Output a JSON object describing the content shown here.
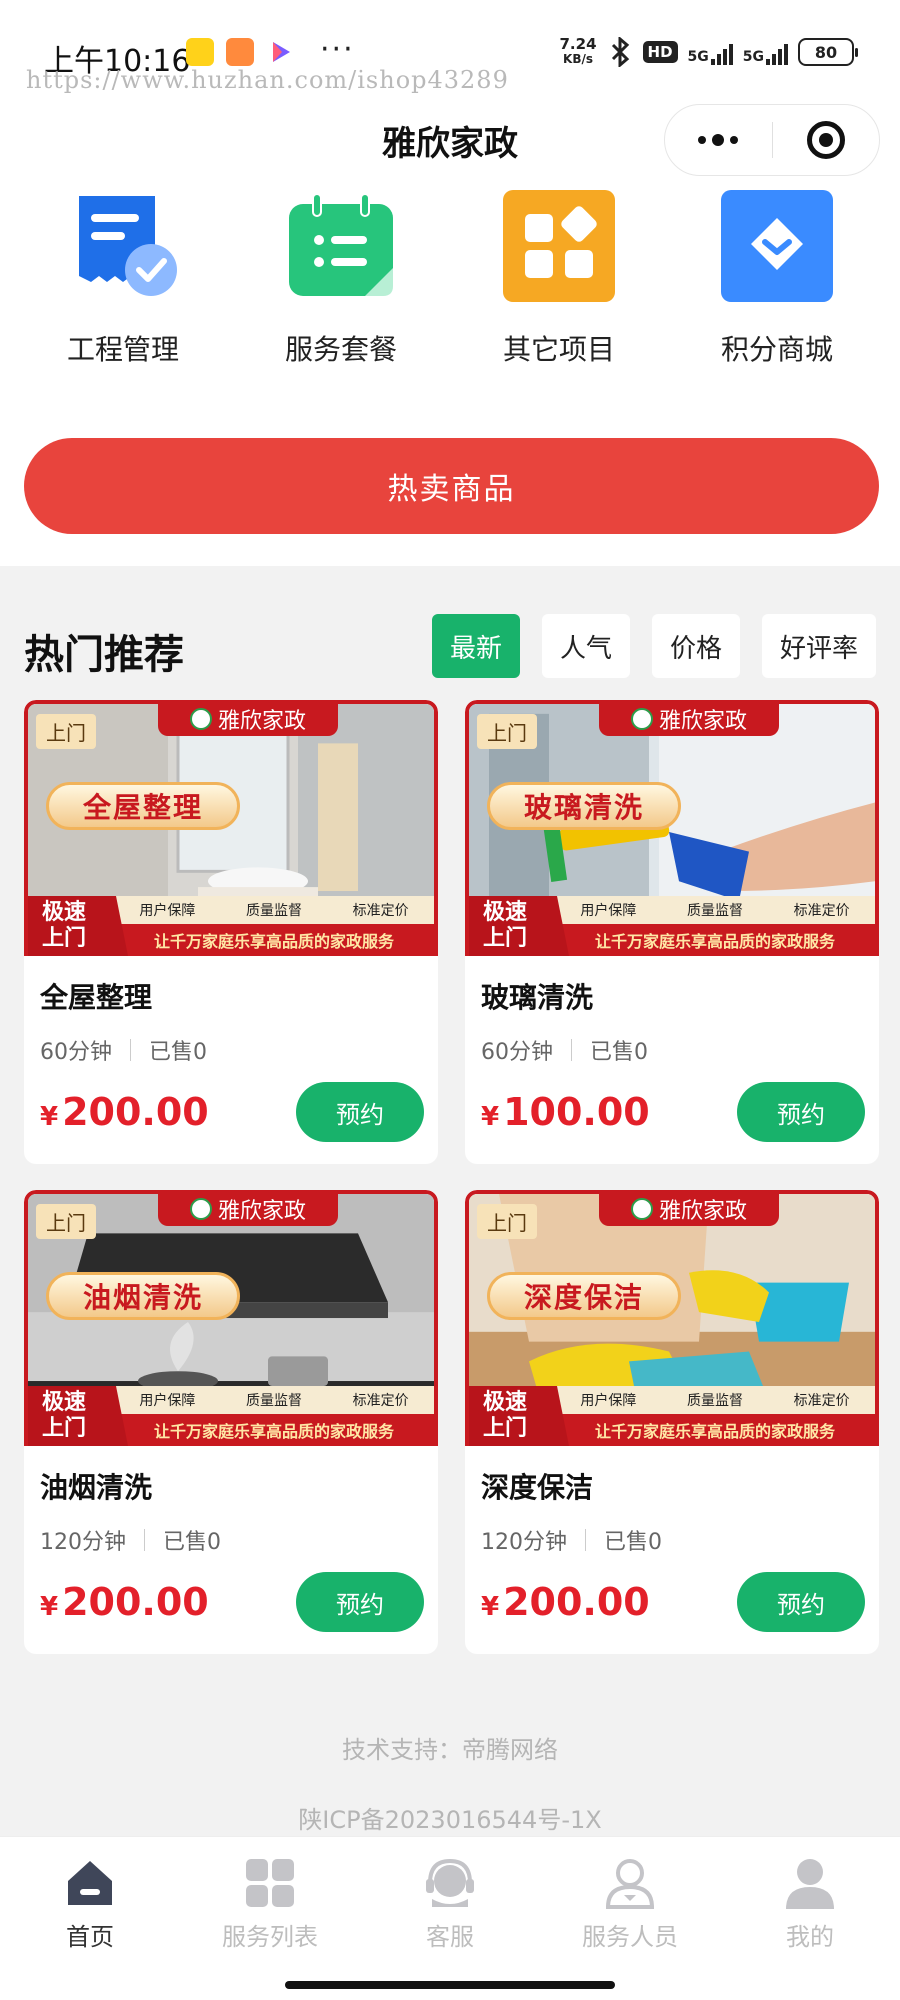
{
  "status_bar": {
    "time": "上午10:16",
    "more": "···",
    "watermark": "https://www.huzhan.com/ishop43289",
    "net_speed_value": "7.24",
    "net_speed_unit": "KB/s",
    "hd_badge": "HD",
    "signal1_label": "5G",
    "signal2_label": "5G",
    "battery": "80"
  },
  "nav": {
    "title": "雅欣家政"
  },
  "quick_menu": [
    {
      "label": "工程管理",
      "icon": "document-check-icon",
      "color": "#1f6fe8"
    },
    {
      "label": "服务套餐",
      "icon": "calendar-list-icon",
      "color": "#27c57c"
    },
    {
      "label": "其它项目",
      "icon": "grid-apps-icon",
      "color": "#f6a823"
    },
    {
      "label": "积分商城",
      "icon": "diamond-icon",
      "color": "#3a8bff"
    }
  ],
  "hot_button": {
    "label": "热卖商品"
  },
  "recommend": {
    "title": "热门推荐",
    "sorts": [
      {
        "label": "最新",
        "active": true
      },
      {
        "label": "人气",
        "active": false
      },
      {
        "label": "价格",
        "active": false
      },
      {
        "label": "好评率",
        "active": false
      }
    ]
  },
  "banner_common": {
    "brand": "雅欣家政",
    "onsite_tag": "上门",
    "speed_line1": "极速",
    "speed_line2": "上门",
    "feature1": "用户保障",
    "feature2": "质量监督",
    "feature3": "标准定价",
    "slogan": "让千万家庭乐享高品质的家政服务"
  },
  "products": [
    {
      "banner_name": "全屋整理",
      "title": "全屋整理",
      "duration": "60分钟",
      "sold": "已售0",
      "currency": "¥",
      "price": "200.00",
      "button": "预约",
      "photo": "bathroom"
    },
    {
      "banner_name": "玻璃清洗",
      "title": "玻璃清洗",
      "duration": "60分钟",
      "sold": "已售0",
      "currency": "¥",
      "price": "100.00",
      "button": "预约",
      "photo": "window"
    },
    {
      "banner_name": "油烟清洗",
      "title": "油烟清洗",
      "duration": "120分钟",
      "sold": "已售0",
      "currency": "¥",
      "price": "200.00",
      "button": "预约",
      "photo": "kitchen"
    },
    {
      "banner_name": "深度保洁",
      "title": "深度保洁",
      "duration": "120分钟",
      "sold": "已售0",
      "currency": "¥",
      "price": "200.00",
      "button": "预约",
      "photo": "floor"
    }
  ],
  "footer": {
    "support": "技术支持：帝腾网络",
    "icp": "陕ICP备2023016544号-1X"
  },
  "tabbar": [
    {
      "label": "首页",
      "icon": "home-icon",
      "active": true
    },
    {
      "label": "服务列表",
      "icon": "grid-icon",
      "active": false
    },
    {
      "label": "客服",
      "icon": "headset-icon",
      "active": false
    },
    {
      "label": "服务人员",
      "icon": "staff-icon",
      "active": false
    },
    {
      "label": "我的",
      "icon": "user-icon",
      "active": false
    }
  ],
  "colors": {
    "brand_green": "#18b26b",
    "hot_red": "#e8443d",
    "price_red": "#e3202a",
    "banner_red": "#c8191f"
  }
}
